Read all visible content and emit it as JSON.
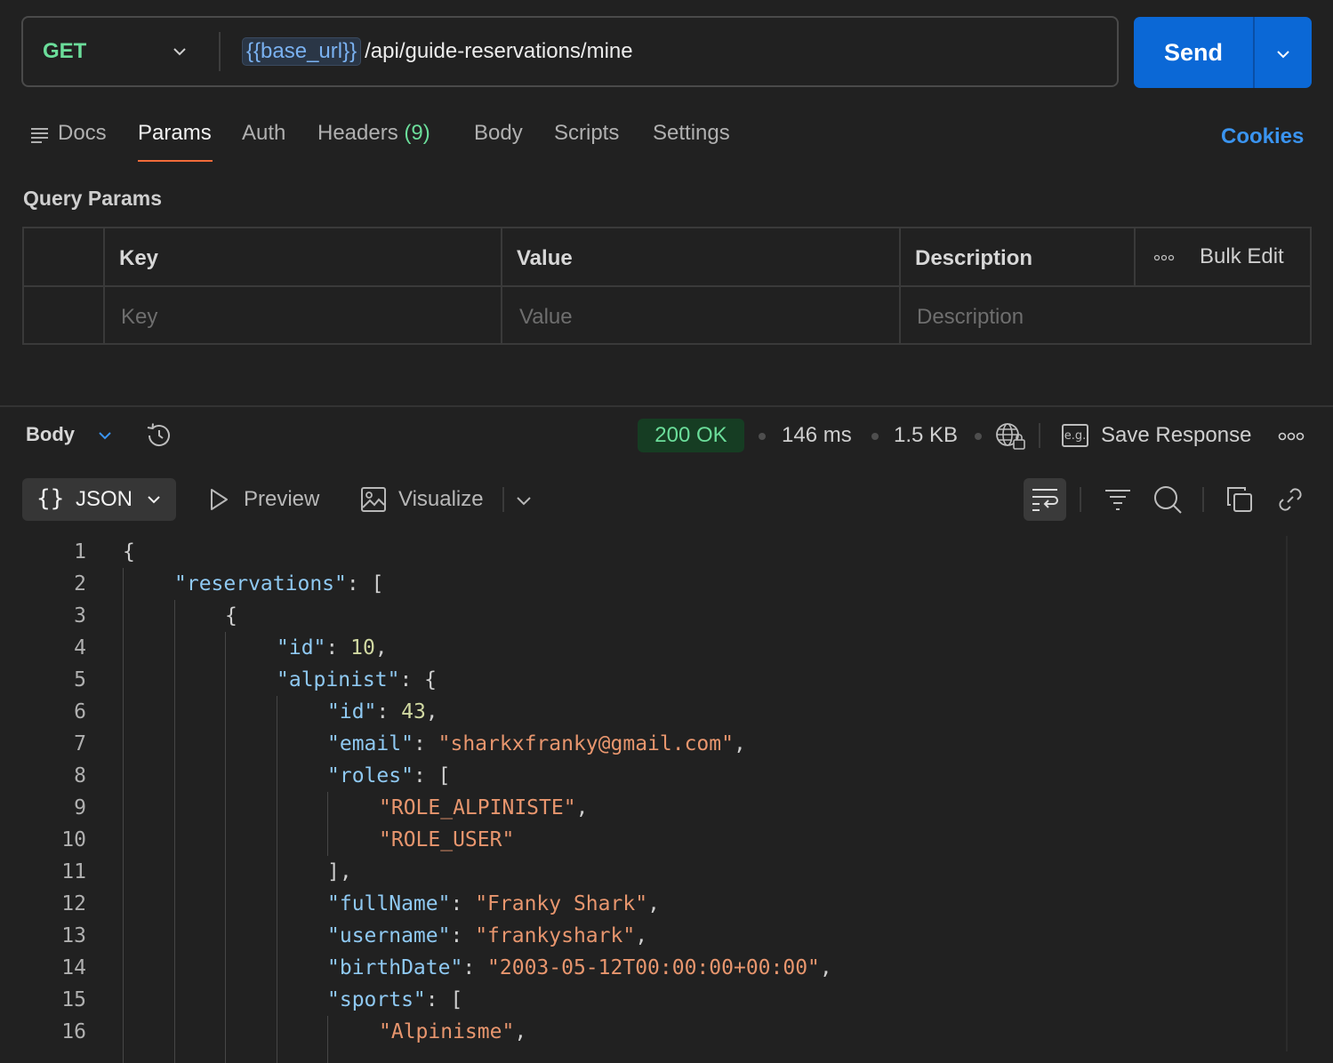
{
  "request": {
    "method": "GET",
    "url_variable": "{{base_url}}",
    "url_path": "/api/guide-reservations/mine",
    "send_label": "Send"
  },
  "tabs": {
    "docs": "Docs",
    "params": "Params",
    "auth": "Auth",
    "headers": "Headers",
    "headers_count": "(9)",
    "body": "Body",
    "scripts": "Scripts",
    "settings": "Settings",
    "cookies": "Cookies"
  },
  "query_params": {
    "title": "Query Params",
    "headers": {
      "key": "Key",
      "value": "Value",
      "description": "Description",
      "bulk_edit": "Bulk Edit"
    },
    "placeholders": {
      "key": "Key",
      "value": "Value",
      "description": "Description"
    }
  },
  "response": {
    "body_label": "Body",
    "status": "200 OK",
    "time": "146 ms",
    "size": "1.5 KB",
    "save_response": "Save Response",
    "eg_label": "e.g."
  },
  "viewer": {
    "format": "JSON",
    "format_icon": "{}",
    "preview": "Preview",
    "visualize": "Visualize"
  },
  "code": {
    "line_numbers": [
      "1",
      "2",
      "3",
      "4",
      "5",
      "6",
      "7",
      "8",
      "9",
      "10",
      "11",
      "12",
      "13",
      "14",
      "15",
      "16"
    ],
    "lines": {
      "l1": {
        "punct": "{"
      },
      "l2": {
        "key": "\"reservations\"",
        "punct": ": ["
      },
      "l3": {
        "punct": "{"
      },
      "l4": {
        "key": "\"id\"",
        "colon": ": ",
        "value": "10",
        "punct": ","
      },
      "l5": {
        "key": "\"alpinist\"",
        "punct": ": {"
      },
      "l6": {
        "key": "\"id\"",
        "colon": ": ",
        "value": "43",
        "punct": ","
      },
      "l7": {
        "key": "\"email\"",
        "colon": ": ",
        "value": "\"sharkxfranky@gmail.com\"",
        "punct": ","
      },
      "l8": {
        "key": "\"roles\"",
        "punct": ": ["
      },
      "l9": {
        "value": "\"ROLE_ALPINISTE\"",
        "punct": ","
      },
      "l10": {
        "value": "\"ROLE_USER\""
      },
      "l11": {
        "punct": "],"
      },
      "l12": {
        "key": "\"fullName\"",
        "colon": ": ",
        "value": "\"Franky Shark\"",
        "punct": ","
      },
      "l13": {
        "key": "\"username\"",
        "colon": ": ",
        "value": "\"frankyshark\"",
        "punct": ","
      },
      "l14": {
        "key": "\"birthDate\"",
        "colon": ": ",
        "value": "\"2003-05-12T00:00:00+00:00\"",
        "punct": ","
      },
      "l15": {
        "key": "\"sports\"",
        "punct": ": ["
      },
      "l16": {
        "value": "\"Alpinisme\"",
        "punct": ","
      }
    }
  },
  "colors": {
    "method_get": "#6bdd9a",
    "send_button": "#0b68d6",
    "active_tab_underline": "#f26b3a",
    "cookies_link": "#3a94f0",
    "json_key": "#8fc9f2",
    "json_string": "#e8966e",
    "json_number": "#d1d9a2"
  },
  "icons": [
    "chevron-down-icon",
    "docs-list-icon",
    "history-icon",
    "globe-lock-icon",
    "example-icon",
    "more-icon",
    "braces-icon",
    "play-icon",
    "image-icon",
    "wrap-icon",
    "filter-icon",
    "search-icon",
    "copy-icon",
    "link-icon"
  ]
}
